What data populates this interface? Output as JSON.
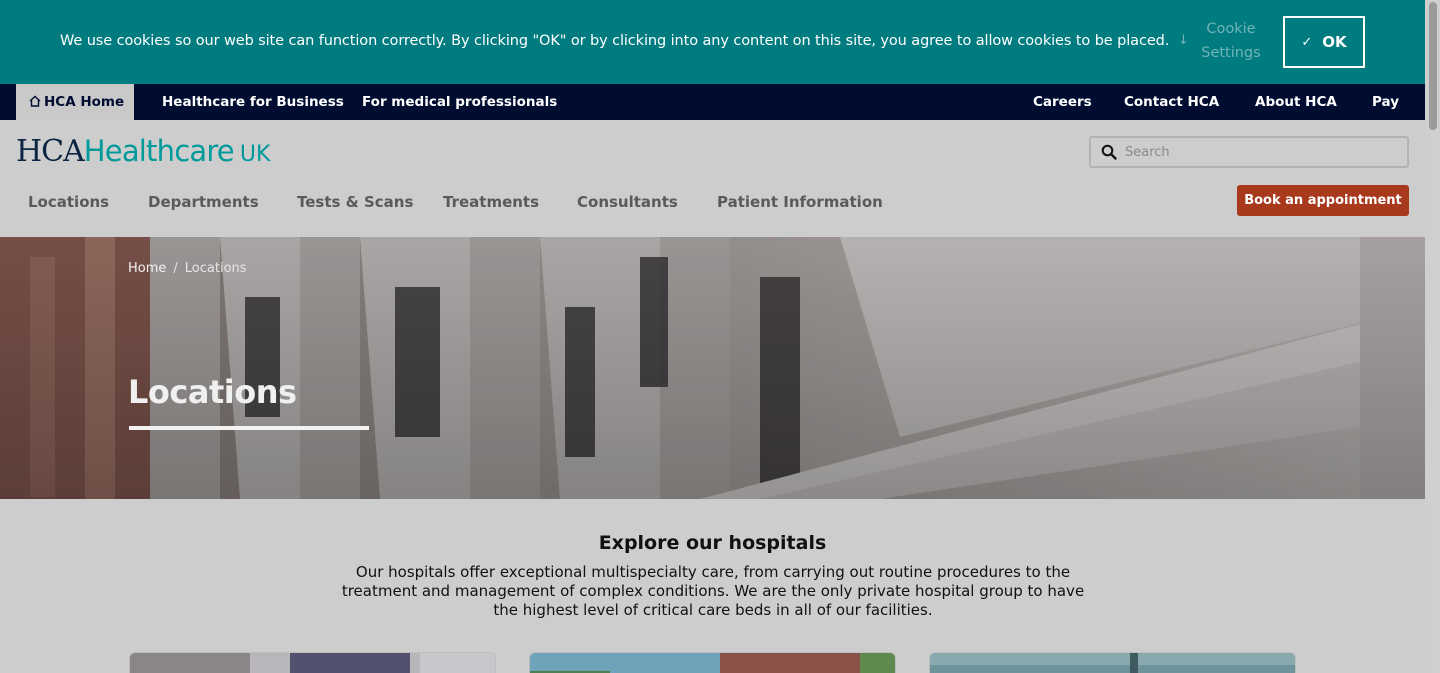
{
  "cookie_banner": {
    "message": "We use cookies so our web site can function correctly. By clicking \"OK\" or by clicking into any content on this site, you agree to allow cookies to be placed.",
    "settings_label_line1": "Cookie",
    "settings_label_line2": "Settings",
    "ok_label": "OK"
  },
  "top_nav": {
    "home": "HCA Home",
    "business": "Healthcare for Business",
    "medical": "For medical professionals",
    "careers": "Careers",
    "contact": "Contact HCA",
    "about": "About HCA",
    "pay": "Pay"
  },
  "logo": {
    "hca": "HCA",
    "healthcare": "Healthcare",
    "uk": "UK"
  },
  "search": {
    "placeholder": "Search"
  },
  "main_nav": {
    "locations": "Locations",
    "departments": "Departments",
    "tests": "Tests & Scans",
    "treatments": "Treatments",
    "consultants": "Consultants",
    "patient_info": "Patient Information",
    "book": "Book an appointment"
  },
  "breadcrumb": {
    "home": "Home",
    "separator": "/",
    "current": "Locations"
  },
  "hero": {
    "title": "Locations"
  },
  "explore": {
    "title": "Explore our hospitals",
    "text": "Our hospitals offer exceptional multispecialty care, from carrying out routine procedures to the treatment and management of complex conditions. We are the only private hospital group to have the highest level of critical care beds in all of our facilities."
  },
  "colors": {
    "banner": "#007b80",
    "top_nav": "#000d30",
    "accent": "#009a9a",
    "book_button": "#a8391d"
  }
}
